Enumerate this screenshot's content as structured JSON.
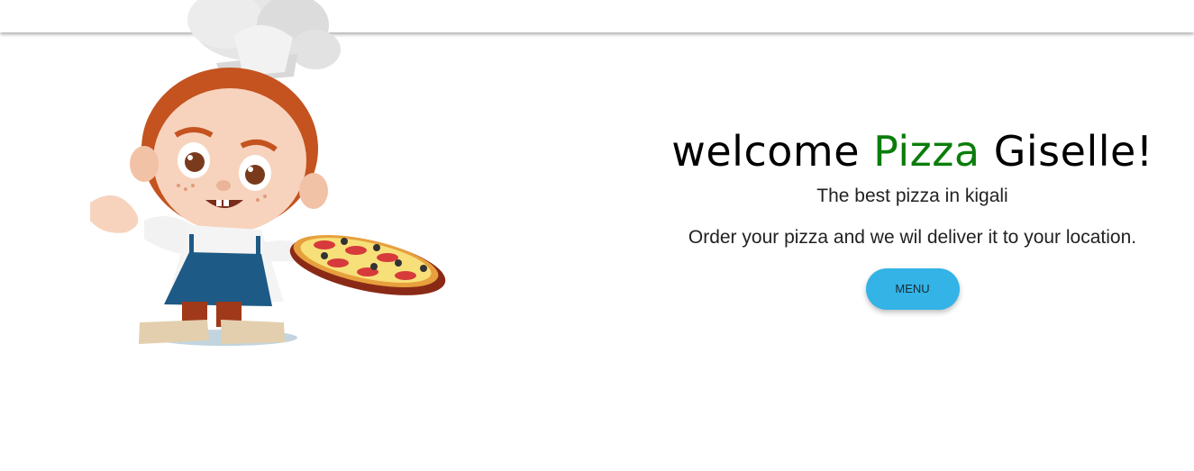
{
  "hero": {
    "headline_part1": "welcome ",
    "headline_brand": "Pizza",
    "headline_part2": " Giselle!",
    "tagline": "The best pizza in kigali",
    "subtagline": "Order your pizza and we wil deliver it to your location.",
    "menu_button_label": "MENU"
  },
  "colors": {
    "brand_green": "#0a7d0a",
    "button_blue": "#33b3e6"
  }
}
